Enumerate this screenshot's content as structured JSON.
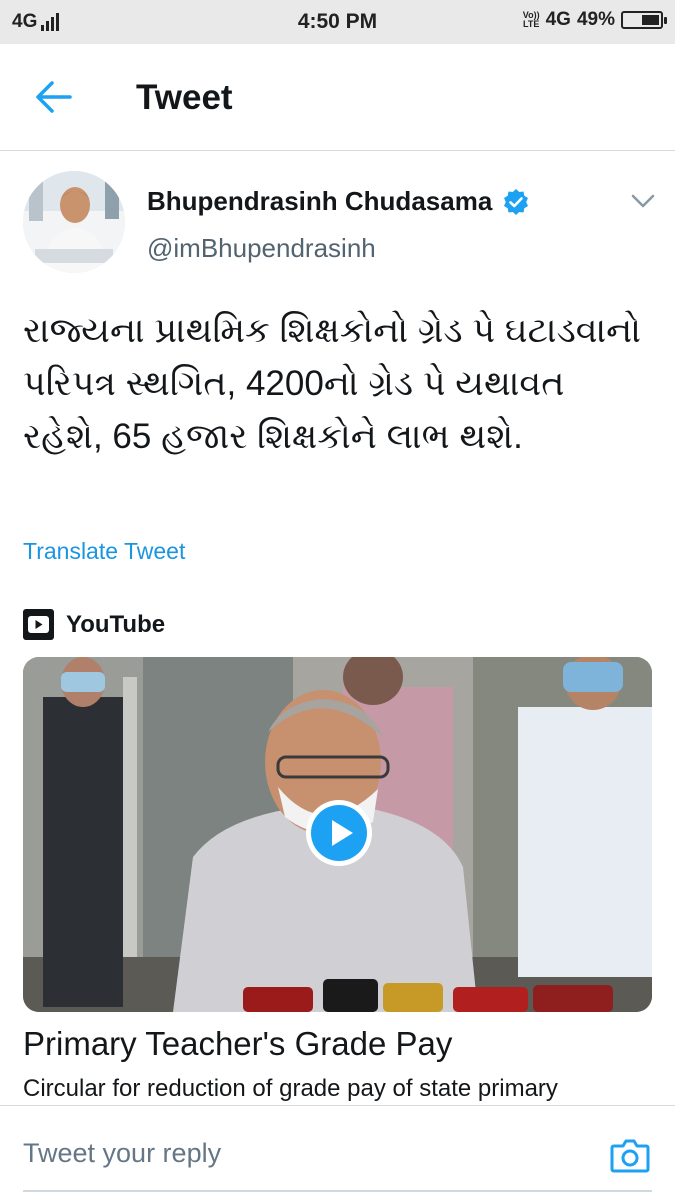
{
  "status_bar": {
    "network": "4G",
    "time": "4:50 PM",
    "volte_top": "Vo))",
    "volte_bottom": "LTE",
    "network_right": "4G",
    "battery": "49%",
    "battery_level": 0.49
  },
  "header": {
    "title": "Tweet",
    "back_icon": "arrow-left-icon"
  },
  "tweet": {
    "author_name": "Bhupendrasinh Chudasama",
    "handle": "@imBhupendrasinh",
    "verified": true,
    "text": "રાજ્યના પ્રાથમિક શિક્ષકોનો ગ્રેડ પે ઘટાડવાનો પરિપત્ર સ્થગિત, 4200નો ગ્રેડ પે યથાવત રહેશે, 65 હજાર શિક્ષકોને લાભ થશે.",
    "translate_label": "Translate Tweet"
  },
  "card": {
    "source": "YouTube",
    "title": "Primary Teacher's Grade Pay",
    "description": "Circular for reduction of grade pay of state primary"
  },
  "reply": {
    "placeholder": "Tweet your reply"
  },
  "colors": {
    "accent": "#1da1f2",
    "link": "#1b95e0",
    "status_bar_bg": "#e9e9ea"
  }
}
